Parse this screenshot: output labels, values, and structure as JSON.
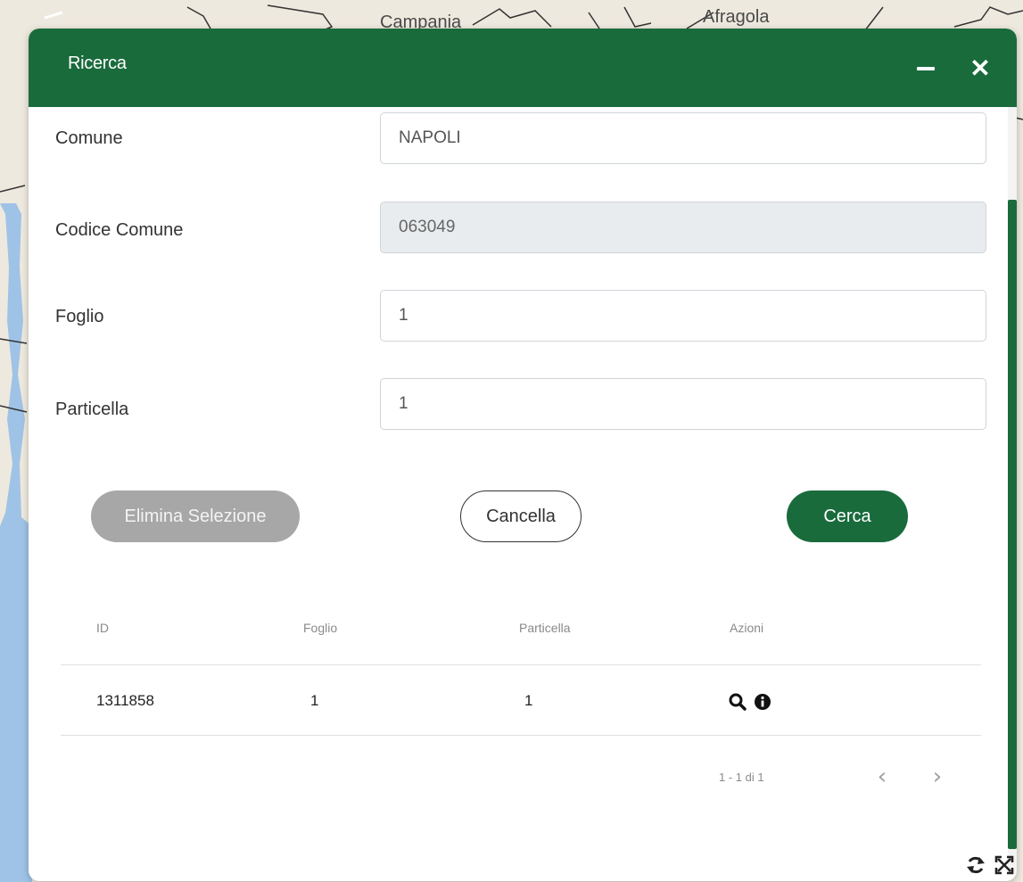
{
  "map": {
    "labels": [
      "Campania",
      "Afragola"
    ]
  },
  "dialog": {
    "title": "Ricerca",
    "header_color": "#1a6b3c"
  },
  "form": {
    "comune": {
      "label": "Comune",
      "value": "NAPOLI"
    },
    "codice_comune": {
      "label": "Codice Comune",
      "value": "063049"
    },
    "foglio": {
      "label": "Foglio",
      "value": "1"
    },
    "particella": {
      "label": "Particella",
      "value": "1"
    }
  },
  "buttons": {
    "elimina": "Elimina Selezione",
    "cancella": "Cancella",
    "cerca": "Cerca"
  },
  "table": {
    "headers": [
      "ID",
      "Foglio",
      "Particella",
      "Azioni"
    ],
    "rows": [
      {
        "id": "1311858",
        "foglio": "1",
        "particella": "1",
        "actions": [
          "search-icon",
          "info-icon"
        ]
      }
    ]
  },
  "paginator": {
    "range": "1 - 1 di 1",
    "prev": "‹",
    "next": "›"
  },
  "icons": {
    "minimize": "minimize-icon",
    "close": "close-icon",
    "refresh": "refresh-icon",
    "fullscreen": "fullscreen-icon"
  }
}
